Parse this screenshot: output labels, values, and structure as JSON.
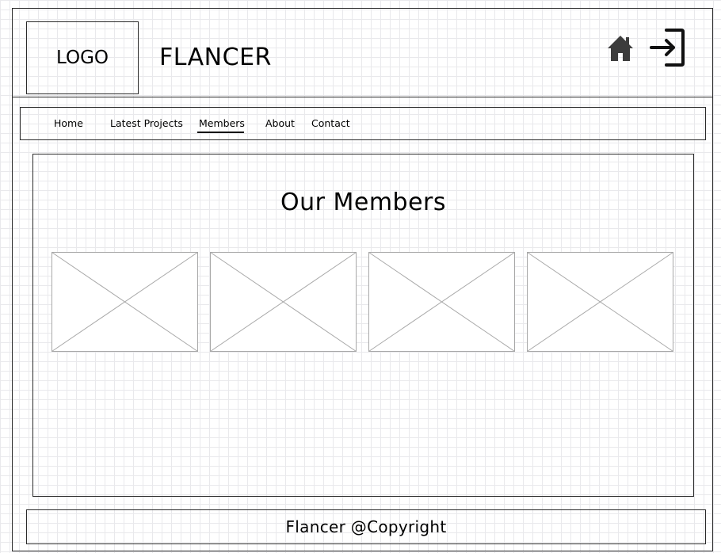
{
  "header": {
    "logo_label": "LOGO",
    "site_title": "FLANCER",
    "icons": {
      "home": "home-icon",
      "login": "login-icon"
    }
  },
  "nav": {
    "items": [
      {
        "label": "Home",
        "active": false
      },
      {
        "label": "Latest Projects",
        "active": false
      },
      {
        "label": "Members",
        "active": true
      },
      {
        "label": "About",
        "active": false
      },
      {
        "label": "Contact",
        "active": false
      }
    ]
  },
  "main": {
    "title": "Our Members",
    "members": [
      {
        "image": "image-placeholder"
      },
      {
        "image": "image-placeholder"
      },
      {
        "image": "image-placeholder"
      },
      {
        "image": "image-placeholder"
      }
    ]
  },
  "footer": {
    "text": "Flancer @Copyright"
  },
  "colors": {
    "line": "#2a2a2a",
    "grid": "#e9e9ec",
    "placeholder": "#a8a8a8",
    "icon": "#3c3c3c"
  }
}
